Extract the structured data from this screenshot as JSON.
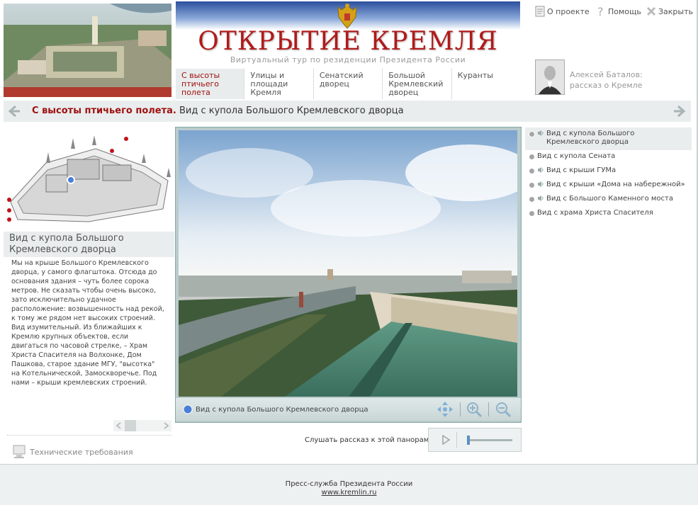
{
  "header": {
    "title": "ОТКРЫТИЕ КРЕМЛЯ",
    "subtitle": "Виртуальный тур по резиденции Президента России",
    "links": {
      "about": "О проекте",
      "help": "Помощь",
      "close": "Закрыть"
    }
  },
  "nav": {
    "items": [
      {
        "label": "С высоты птичьего полета",
        "active": true
      },
      {
        "label": "Улицы и площади Кремля",
        "active": false
      },
      {
        "label": "Сенатский дворец",
        "active": false
      },
      {
        "label": "Большой Кремлевский дворец",
        "active": false
      },
      {
        "label": "Куранты",
        "active": false
      }
    ]
  },
  "narrator": {
    "name": "Алексей Баталов:",
    "subtitle": "рассказ о Кремле"
  },
  "breadcrumb": {
    "section": "С высоты птичьего полета.",
    "page": "Вид с купола Большого Кремлевского дворца"
  },
  "place": {
    "title": "Вид с купола Большого Кремлевского дворца",
    "description": "Мы на крыше Большого Кремлевского дворца, у самого флагштока. Отсюда до основания здания – чуть более сорока метров. Не сказать чтобы очень высоко, зато исключительно удачное расположение: возвышенность над рекой, к тому же рядом нет высоких строений. Вид изумительный. Из ближайших к Кремлю крупных объектов, если двигаться по часовой стрелке, – Храм Христа Спасителя на Волхонке, Дом Пашкова, старое здание МГУ, \"высотка\" на Котельнической, Замоскворечье. Под нами – крыши кремлевских строений."
  },
  "panorama": {
    "caption": "Вид с купола Большого Кремлевского дворца",
    "listen_label": "Слушать рассказ к этой панораме"
  },
  "panorama_list": [
    {
      "label": "Вид с купола Большого Кремлевского дворца",
      "audio": true,
      "active": true
    },
    {
      "label": "Вид с купола Сената",
      "audio": false,
      "active": false
    },
    {
      "label": "Вид с крыши ГУМа",
      "audio": true,
      "active": false
    },
    {
      "label": "Вид с крыши «Дома на набережной»",
      "audio": true,
      "active": false
    },
    {
      "label": "Вид с Большого Каменного моста",
      "audio": true,
      "active": false
    },
    {
      "label": "Вид с храма Христа Спасителя",
      "audio": false,
      "active": false
    }
  ],
  "tech_requirements": "Технические требования",
  "footer": {
    "press": "Пресс-служба Президента России",
    "link": "www.kremlin.ru"
  },
  "colors": {
    "accent": "#a01010",
    "panel": "#e9eded",
    "frame": "#b9cbcb"
  }
}
